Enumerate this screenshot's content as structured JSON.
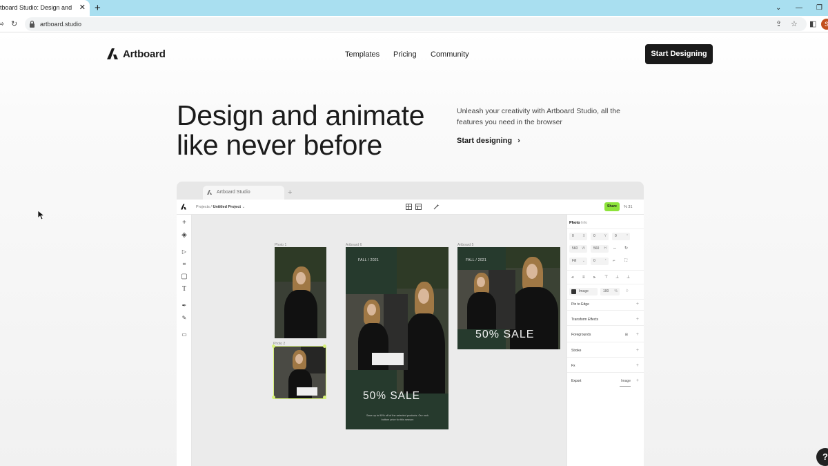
{
  "browser": {
    "tab_title": "rtboard Studio: Design and Ani",
    "tab_close": "✕",
    "new_tab": "+",
    "url": "artboard.studio",
    "profile_initial": "S"
  },
  "site": {
    "brand": "Artboard",
    "nav": [
      "Templates",
      "Pricing",
      "Community"
    ],
    "cta": "Start Designing",
    "headline_line1": "Design and animate",
    "headline_line2": "like never before",
    "subtitle": "Unleash your creativity with Artboard Studio, all the features you need in the browser",
    "start_link": "Start designing",
    "help": "?"
  },
  "app": {
    "tab_title": "Artboard Studio",
    "tab_plus": "+",
    "breadcrumb_parent": "Projects / ",
    "breadcrumb_current": "Untitled Project",
    "share": "Share",
    "zoom": "% 31",
    "canvas": {
      "photo1_label": "Photo 1",
      "photo2_label": "Photo 2",
      "artboard1_label": "Artboard 6",
      "artboard2_label": "Artboard 5",
      "fall_text": "FALL / 2021",
      "sale_text": "50%  SALE",
      "fine_print": "Save up to 90% off of the selected products. Our rock bottom price for this season"
    },
    "panel": {
      "tabs": [
        "Photo",
        "Info"
      ],
      "x": "0",
      "y": "0",
      "rotation": "0",
      "w": "560",
      "h": "560",
      "fit": "Fill",
      "radius": "0",
      "fill_type": "Image",
      "opacity": "100",
      "opacity_unit": "%",
      "sections": [
        "Pin to Edge",
        "Transform Effects",
        "Foregrounds",
        "Stroke",
        "Fx",
        "Export"
      ],
      "export_format": "Image"
    }
  }
}
